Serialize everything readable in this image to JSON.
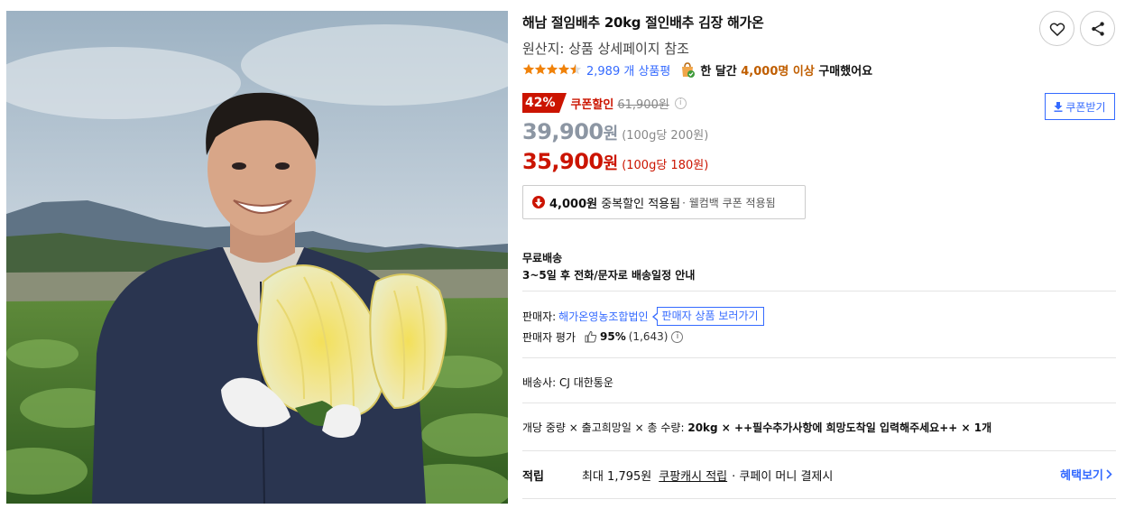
{
  "colors": {
    "accent_red": "#cb1400",
    "link_blue": "#346aff",
    "star_orange": "#f0820a",
    "highlight_orange": "#c05e00",
    "muted_price": "#8c96a3"
  },
  "product": {
    "title": "해남 절임배추 20kg 절인배추 김장 해가온",
    "origin": "원산지: 상품 상세페이지 참조",
    "rating": 4.5,
    "review_count": "2,989 개 상품평",
    "buy_prefix": "한 달간",
    "buy_count": "4,000명 이상",
    "buy_suffix": "구매했어요"
  },
  "icons": {
    "like": "heart-icon",
    "share": "share-icon",
    "download": "download-icon",
    "chevron": "chevron-right-icon"
  },
  "pricing": {
    "discount_badge": "42%",
    "coupon_label": "쿠폰할인",
    "original_price": "61,900원",
    "coupon_button": "쿠폰받기",
    "price_before_amount": "39,900",
    "price_before_won": "원",
    "price_before_unit": "(100g당 200원)",
    "price_final_amount": "35,900",
    "price_final_won": "원",
    "price_final_unit": "(100g당 180원)",
    "extra_discount_amount": "4,000원",
    "extra_discount_text": "중복할인 적용됨",
    "extra_discount_sub": "· 웰컴백 쿠폰 적용됨"
  },
  "shipping": {
    "title": "무료배송",
    "detail": "3~5일 후 전화/문자로 배송일정 안내"
  },
  "seller": {
    "label": "판매자:",
    "name": "해가온영농조합법인",
    "link": "판매자 상품 보러가기",
    "rating_label": "판매자 평가",
    "rating_pct": "95%",
    "rating_count": "(1,643)"
  },
  "carrier": {
    "text": "배송사:  CJ 대한통운"
  },
  "option": {
    "label": "개당 중량 × 출고희망일 × 총 수량:",
    "value": "20kg × ++필수추가사항에 희망도착일 입력해주세요++ × 1개"
  },
  "reward": {
    "label": "적립",
    "max": "최대 1,795원",
    "cash": "쿠팡캐시 적립",
    "suffix": "· 쿠페이 머니 결제시",
    "benefit_link": "혜택보기"
  }
}
